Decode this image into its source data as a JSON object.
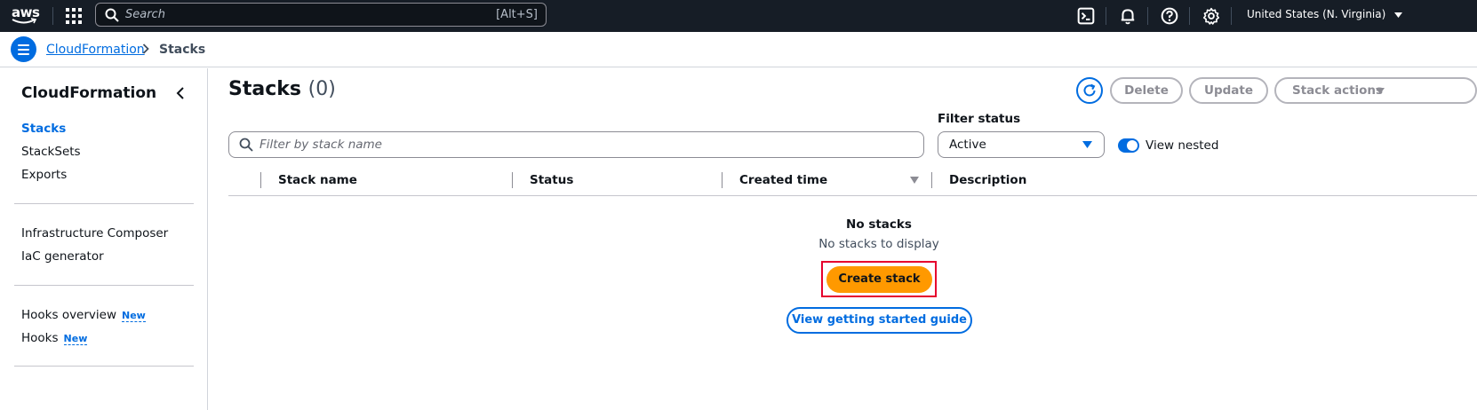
{
  "topnav": {
    "logo_text": "aws",
    "search_placeholder": "Search",
    "search_shortcut": "[Alt+S]",
    "region": "United States (N. Virginia)"
  },
  "breadcrumb": {
    "parent": "CloudFormation",
    "current": "Stacks"
  },
  "sidebar": {
    "title": "CloudFormation",
    "groups": [
      [
        {
          "label": "Stacks",
          "active": true
        },
        {
          "label": "StackSets"
        },
        {
          "label": "Exports"
        }
      ],
      [
        {
          "label": "Infrastructure Composer"
        },
        {
          "label": "IaC generator"
        }
      ],
      [
        {
          "label": "Hooks overview",
          "badge": "New"
        },
        {
          "label": "Hooks",
          "badge": "New"
        }
      ]
    ]
  },
  "main": {
    "title": "Stacks",
    "count": "(0)",
    "buttons": {
      "delete": "Delete",
      "update": "Update",
      "stack_actions": "Stack actions"
    },
    "filter": {
      "placeholder": "Filter by stack name",
      "status_label": "Filter status",
      "status_value": "Active",
      "view_nested_label": "View nested",
      "view_nested_on": true
    },
    "table": {
      "columns": [
        "Stack name",
        "Status",
        "Created time",
        "Description"
      ]
    },
    "empty": {
      "title": "No stacks",
      "subtitle": "No stacks to display",
      "create_button": "Create stack",
      "guide_button": "View getting started guide"
    }
  },
  "colors": {
    "accent": "#006ce0",
    "primary_button": "#ff9900",
    "topnav_bg": "#161d26",
    "highlight": "#e6002e"
  }
}
